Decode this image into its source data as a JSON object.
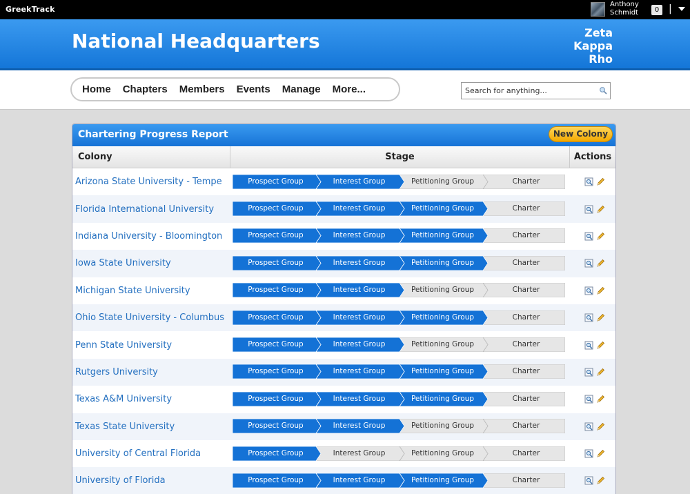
{
  "topbar": {
    "brand": "GreekTrack",
    "user_first": "Anthony",
    "user_last": "Schmidt",
    "notifications": "0",
    "separator": "|"
  },
  "header": {
    "title": "National Headquarters",
    "org_line1": "Zeta",
    "org_line2": "Kappa",
    "org_line3": "Rho"
  },
  "nav": {
    "items": [
      "Home",
      "Chapters",
      "Members",
      "Events",
      "Manage",
      "More..."
    ]
  },
  "search": {
    "placeholder": "Search for anything..."
  },
  "panel": {
    "title": "Chartering Progress Report",
    "new_button": "New Colony",
    "columns": [
      "Colony",
      "Stage",
      "Actions"
    ]
  },
  "stage_names": [
    "Prospect Group",
    "Interest Group",
    "Petitioning Group",
    "Charter"
  ],
  "colors": {
    "stage_active": "#1472d6",
    "stage_inactive": "#e6e6e6",
    "link": "#2470c0",
    "accent": "#f2a800"
  },
  "colonies": [
    {
      "name": "Arizona State University - Tempe",
      "completed": 2
    },
    {
      "name": "Florida International University",
      "completed": 3
    },
    {
      "name": "Indiana University - Bloomington",
      "completed": 3
    },
    {
      "name": "Iowa State University",
      "completed": 3
    },
    {
      "name": "Michigan State University",
      "completed": 2
    },
    {
      "name": "Ohio State University - Columbus",
      "completed": 3
    },
    {
      "name": "Penn State University",
      "completed": 2
    },
    {
      "name": "Rutgers University",
      "completed": 3
    },
    {
      "name": "Texas A&M University",
      "completed": 3
    },
    {
      "name": "Texas State University",
      "completed": 2
    },
    {
      "name": "University of Central Florida",
      "completed": 1
    },
    {
      "name": "University of Florida",
      "completed": 3
    }
  ]
}
